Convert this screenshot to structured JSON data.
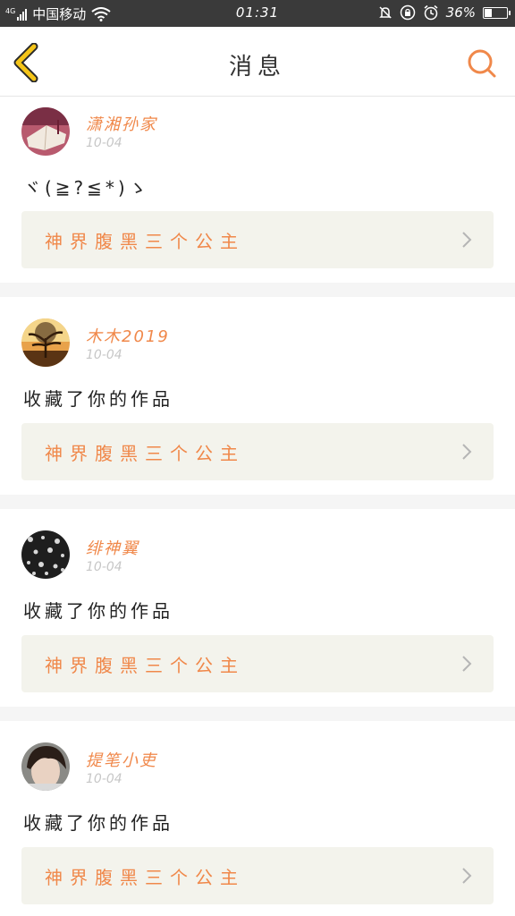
{
  "status_bar": {
    "network": "4G",
    "carrier": "中国移动",
    "time": "01:31",
    "battery": "36%",
    "battery_level": 0.36
  },
  "header": {
    "title": "消息",
    "back_icon": "chevron-left-icon",
    "search_icon": "search-icon"
  },
  "colors": {
    "accent": "#f0884a",
    "back": "#f5c518",
    "card_bg": "#f3f3ec",
    "separator": "#f5f5f5"
  },
  "messages": [
    {
      "name": "潇湘孙家",
      "date": "10-04",
      "text": "ヾ(≧?≦*)ゝ",
      "work": "神界腹黑三个公主"
    },
    {
      "name": "木木2019",
      "date": "10-04",
      "text": "收藏了你的作品",
      "work": "神界腹黑三个公主"
    },
    {
      "name": "绯神翼",
      "date": "10-04",
      "text": "收藏了你的作品",
      "work": "神界腹黑三个公主"
    },
    {
      "name": "提笔小吏",
      "date": "10-04",
      "text": "收藏了你的作品",
      "work": "神界腹黑三个公主"
    }
  ]
}
